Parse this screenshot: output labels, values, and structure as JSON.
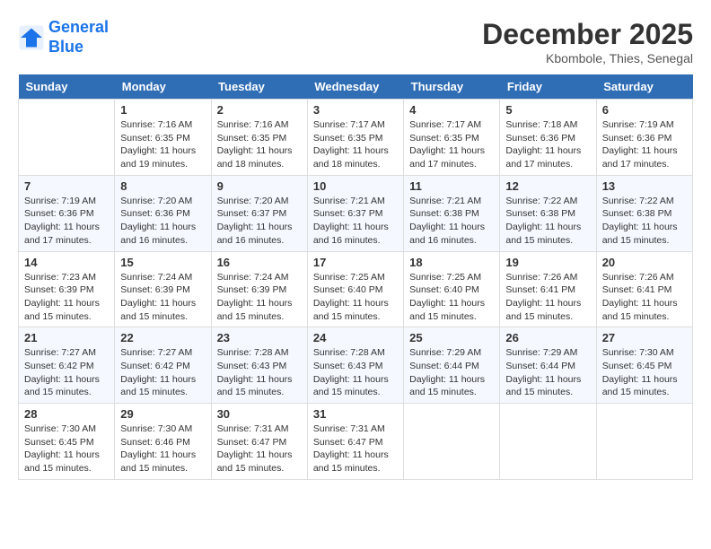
{
  "header": {
    "logo_line1": "General",
    "logo_line2": "Blue",
    "month_title": "December 2025",
    "location": "Kbombole, Thies, Senegal"
  },
  "days_of_week": [
    "Sunday",
    "Monday",
    "Tuesday",
    "Wednesday",
    "Thursday",
    "Friday",
    "Saturday"
  ],
  "weeks": [
    [
      {
        "day": "",
        "info": ""
      },
      {
        "day": "1",
        "info": "Sunrise: 7:16 AM\nSunset: 6:35 PM\nDaylight: 11 hours\nand 19 minutes."
      },
      {
        "day": "2",
        "info": "Sunrise: 7:16 AM\nSunset: 6:35 PM\nDaylight: 11 hours\nand 18 minutes."
      },
      {
        "day": "3",
        "info": "Sunrise: 7:17 AM\nSunset: 6:35 PM\nDaylight: 11 hours\nand 18 minutes."
      },
      {
        "day": "4",
        "info": "Sunrise: 7:17 AM\nSunset: 6:35 PM\nDaylight: 11 hours\nand 17 minutes."
      },
      {
        "day": "5",
        "info": "Sunrise: 7:18 AM\nSunset: 6:36 PM\nDaylight: 11 hours\nand 17 minutes."
      },
      {
        "day": "6",
        "info": "Sunrise: 7:19 AM\nSunset: 6:36 PM\nDaylight: 11 hours\nand 17 minutes."
      }
    ],
    [
      {
        "day": "7",
        "info": "Sunrise: 7:19 AM\nSunset: 6:36 PM\nDaylight: 11 hours\nand 17 minutes."
      },
      {
        "day": "8",
        "info": "Sunrise: 7:20 AM\nSunset: 6:36 PM\nDaylight: 11 hours\nand 16 minutes."
      },
      {
        "day": "9",
        "info": "Sunrise: 7:20 AM\nSunset: 6:37 PM\nDaylight: 11 hours\nand 16 minutes."
      },
      {
        "day": "10",
        "info": "Sunrise: 7:21 AM\nSunset: 6:37 PM\nDaylight: 11 hours\nand 16 minutes."
      },
      {
        "day": "11",
        "info": "Sunrise: 7:21 AM\nSunset: 6:38 PM\nDaylight: 11 hours\nand 16 minutes."
      },
      {
        "day": "12",
        "info": "Sunrise: 7:22 AM\nSunset: 6:38 PM\nDaylight: 11 hours\nand 15 minutes."
      },
      {
        "day": "13",
        "info": "Sunrise: 7:22 AM\nSunset: 6:38 PM\nDaylight: 11 hours\nand 15 minutes."
      }
    ],
    [
      {
        "day": "14",
        "info": "Sunrise: 7:23 AM\nSunset: 6:39 PM\nDaylight: 11 hours\nand 15 minutes."
      },
      {
        "day": "15",
        "info": "Sunrise: 7:24 AM\nSunset: 6:39 PM\nDaylight: 11 hours\nand 15 minutes."
      },
      {
        "day": "16",
        "info": "Sunrise: 7:24 AM\nSunset: 6:39 PM\nDaylight: 11 hours\nand 15 minutes."
      },
      {
        "day": "17",
        "info": "Sunrise: 7:25 AM\nSunset: 6:40 PM\nDaylight: 11 hours\nand 15 minutes."
      },
      {
        "day": "18",
        "info": "Sunrise: 7:25 AM\nSunset: 6:40 PM\nDaylight: 11 hours\nand 15 minutes."
      },
      {
        "day": "19",
        "info": "Sunrise: 7:26 AM\nSunset: 6:41 PM\nDaylight: 11 hours\nand 15 minutes."
      },
      {
        "day": "20",
        "info": "Sunrise: 7:26 AM\nSunset: 6:41 PM\nDaylight: 11 hours\nand 15 minutes."
      }
    ],
    [
      {
        "day": "21",
        "info": "Sunrise: 7:27 AM\nSunset: 6:42 PM\nDaylight: 11 hours\nand 15 minutes."
      },
      {
        "day": "22",
        "info": "Sunrise: 7:27 AM\nSunset: 6:42 PM\nDaylight: 11 hours\nand 15 minutes."
      },
      {
        "day": "23",
        "info": "Sunrise: 7:28 AM\nSunset: 6:43 PM\nDaylight: 11 hours\nand 15 minutes."
      },
      {
        "day": "24",
        "info": "Sunrise: 7:28 AM\nSunset: 6:43 PM\nDaylight: 11 hours\nand 15 minutes."
      },
      {
        "day": "25",
        "info": "Sunrise: 7:29 AM\nSunset: 6:44 PM\nDaylight: 11 hours\nand 15 minutes."
      },
      {
        "day": "26",
        "info": "Sunrise: 7:29 AM\nSunset: 6:44 PM\nDaylight: 11 hours\nand 15 minutes."
      },
      {
        "day": "27",
        "info": "Sunrise: 7:30 AM\nSunset: 6:45 PM\nDaylight: 11 hours\nand 15 minutes."
      }
    ],
    [
      {
        "day": "28",
        "info": "Sunrise: 7:30 AM\nSunset: 6:45 PM\nDaylight: 11 hours\nand 15 minutes."
      },
      {
        "day": "29",
        "info": "Sunrise: 7:30 AM\nSunset: 6:46 PM\nDaylight: 11 hours\nand 15 minutes."
      },
      {
        "day": "30",
        "info": "Sunrise: 7:31 AM\nSunset: 6:47 PM\nDaylight: 11 hours\nand 15 minutes."
      },
      {
        "day": "31",
        "info": "Sunrise: 7:31 AM\nSunset: 6:47 PM\nDaylight: 11 hours\nand 15 minutes."
      },
      {
        "day": "",
        "info": ""
      },
      {
        "day": "",
        "info": ""
      },
      {
        "day": "",
        "info": ""
      }
    ]
  ]
}
